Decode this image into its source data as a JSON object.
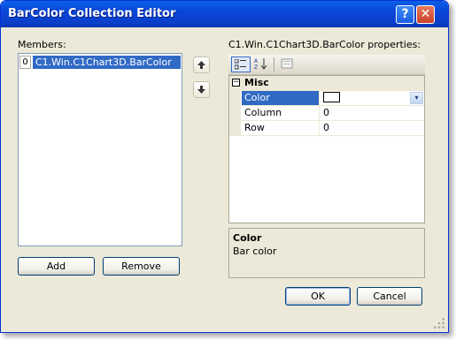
{
  "window": {
    "title": "BarColor Collection Editor",
    "help_button": "?",
    "close_button": "✕"
  },
  "members": {
    "label": "Members:",
    "items": [
      {
        "index": "0",
        "text": "C1.Win.C1Chart3D.BarColor"
      }
    ],
    "move_up_icon": "up-arrow",
    "move_down_icon": "down-arrow"
  },
  "buttons": {
    "add": "Add",
    "remove": "Remove",
    "ok": "OK",
    "cancel": "Cancel"
  },
  "properties": {
    "label": "C1.Win.C1Chart3D.BarColor properties:",
    "toolbar": {
      "categorized_icon": "categorized",
      "alphabetical_icon": "A-Z sort",
      "property_pages_icon": "property-pages"
    },
    "category": {
      "expander": "−",
      "name": "Misc"
    },
    "rows": [
      {
        "name": "Color",
        "value": "",
        "selected": true
      },
      {
        "name": "Column",
        "value": "0",
        "selected": false
      },
      {
        "name": "Row",
        "value": "0",
        "selected": false
      }
    ],
    "dropdown_icon": "▾",
    "help": {
      "title": "Color",
      "description": "Bar color"
    }
  },
  "colors": {
    "title_bar": "#0a46d8",
    "selection": "#316ac5",
    "dialog_bg": "#ece9d8"
  }
}
